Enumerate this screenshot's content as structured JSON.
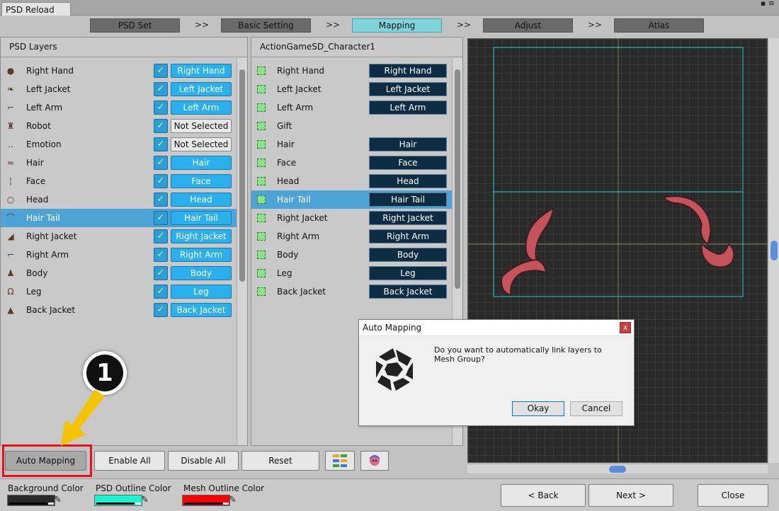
{
  "window": {
    "title": "PSD Reload",
    "controls": "▪ ≡"
  },
  "steps": [
    {
      "label": "PSD Set"
    },
    {
      "label": "Basic Setting"
    },
    {
      "label": "Mapping"
    },
    {
      "label": "Adjust"
    },
    {
      "label": "Atlas"
    }
  ],
  "step_arrow": ">>",
  "psd_panel": {
    "header": "PSD Layers",
    "layers": [
      {
        "name": "Right Hand",
        "icon": "●",
        "map": "Right Hand",
        "mapped": true
      },
      {
        "name": "Left Jacket",
        "icon": "❧",
        "map": "Left Jacket",
        "mapped": true
      },
      {
        "name": "Left Arm",
        "icon": "⌐",
        "map": "Left Arm",
        "mapped": true
      },
      {
        "name": "Robot",
        "icon": "♜",
        "map": "Not Selected",
        "mapped": false
      },
      {
        "name": "Emotion",
        "icon": "‥",
        "map": "Not Selected",
        "mapped": false
      },
      {
        "name": "Hair",
        "icon": "≈",
        "map": "Hair",
        "mapped": true
      },
      {
        "name": "Face",
        "icon": "¦",
        "map": "Face",
        "mapped": true
      },
      {
        "name": "Head",
        "icon": "○",
        "map": "Head",
        "mapped": true
      },
      {
        "name": "Hair Tail",
        "icon": "⌒",
        "map": "Hair Tail",
        "mapped": true
      },
      {
        "name": "Right Jacket",
        "icon": "◢",
        "map": "Right Jacket",
        "mapped": true
      },
      {
        "name": "Right Arm",
        "icon": "⌐",
        "map": "Right Arm",
        "mapped": true
      },
      {
        "name": "Body",
        "icon": "♟",
        "map": "Body",
        "mapped": true
      },
      {
        "name": "Leg",
        "icon": "Ω",
        "map": "Leg",
        "mapped": true
      },
      {
        "name": "Back Jacket",
        "icon": "▲",
        "map": "Back Jacket",
        "mapped": true
      }
    ],
    "selected": "Hair Tail",
    "check_mark": "✓"
  },
  "mesh_panel": {
    "header": "ActionGameSD_Character1",
    "groups": [
      {
        "name": "Right Hand",
        "tag": "Right Hand"
      },
      {
        "name": "Left Jacket",
        "tag": "Left Jacket"
      },
      {
        "name": "Left Arm",
        "tag": "Left Arm"
      },
      {
        "name": "Gift",
        "tag": ""
      },
      {
        "name": "Hair",
        "tag": "Hair"
      },
      {
        "name": "Face",
        "tag": "Face"
      },
      {
        "name": "Head",
        "tag": "Head"
      },
      {
        "name": "Hair Tail",
        "tag": "Hair Tail"
      },
      {
        "name": "Right Jacket",
        "tag": "Right Jacket"
      },
      {
        "name": "Right Arm",
        "tag": "Right Arm"
      },
      {
        "name": "Body",
        "tag": "Body"
      },
      {
        "name": "Leg",
        "tag": "Leg"
      },
      {
        "name": "Back Jacket",
        "tag": "Back Jacket"
      }
    ],
    "selected": "Hair Tail"
  },
  "actions": {
    "auto_mapping": "Auto Mapping",
    "enable_all": "Enable All",
    "disable_all": "Disable All",
    "reset": "Reset"
  },
  "annotation": {
    "badge": "1",
    "highlight_color": "#e8101a",
    "arrow_color": "#f5c400"
  },
  "dialog": {
    "title": "Auto Mapping",
    "message": "Do you want to automatically link layers to Mesh Group?",
    "ok": "Okay",
    "cancel": "Cancel",
    "close": "x",
    "icon": "unity-logo-icon"
  },
  "footer": {
    "background_color_label": "Background Color",
    "psd_outline_label": "PSD Outline Color",
    "mesh_outline_label": "Mesh Outline Color",
    "background_color": "#2a2a2a",
    "psd_outline_color": "#1cf2d0",
    "mesh_outline_color": "#ff0000",
    "back": "< Back",
    "next": "Next >",
    "close": "Close"
  },
  "colors": {
    "mapped_button": "#2ab0ec",
    "mesh_tag": "#0d2d44",
    "selected_row": "#4ea3d6",
    "active_step": "#7fd4dc",
    "hair_tail_fill": "#c6525a"
  }
}
